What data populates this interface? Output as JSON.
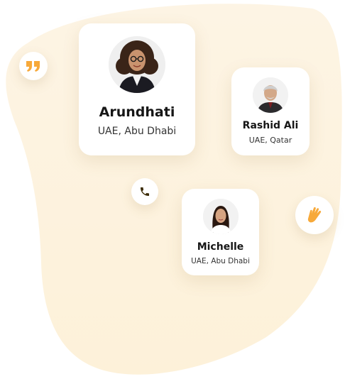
{
  "contacts": [
    {
      "name": "Arundhati",
      "location": "UAE, Abu Dhabi",
      "avatar": "woman-curly-hair-avatar"
    },
    {
      "name": "Rashid Ali",
      "location": "UAE, Qatar",
      "avatar": "man-gray-hair-avatar"
    },
    {
      "name": "Michelle",
      "location": "UAE, Abu Dhabi",
      "avatar": "woman-long-hair-avatar"
    }
  ],
  "badges": [
    {
      "icon": "quote-icon"
    },
    {
      "icon": "phone-icon"
    },
    {
      "icon": "waving-hand-icon"
    }
  ],
  "colors": {
    "background_blob": "#fdf3df",
    "accent_orange": "#f7a93a",
    "text_dark": "#161616",
    "phone_icon": "#3a2a05"
  }
}
